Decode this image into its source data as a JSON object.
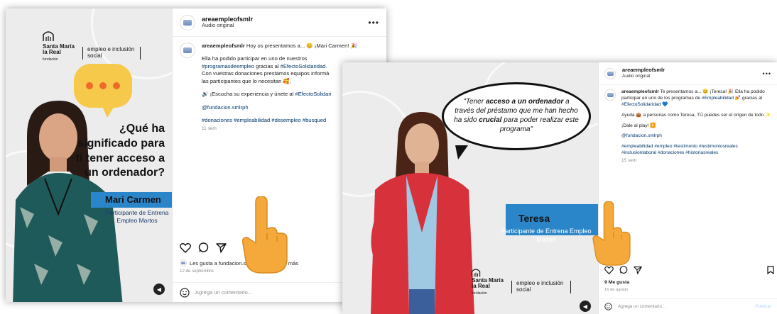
{
  "posts": [
    {
      "username": "areaempleofsmlr",
      "audio": "Audio original",
      "caption": {
        "user": "areaempleofsmlr",
        "line1": "Hoy os presentamos a... 😊 ¡Mari Carmen! 🎉",
        "p1": "Ella ha podido participar en uno de nuestros",
        "tag_programas": "#programasdeempleo",
        "p1b": "gracias al",
        "tag_efecto": "#EfectoSolidaridad.",
        "p1c": "Con vuestras donaciones prestamos equipos informá",
        "p1d": "las participantes que lo necesitan 🥰.",
        "p2": "🔊 ¡Escucha su experiencia y únete al",
        "tag_efecto2": "#EfectoSolidari",
        "mention": "@fundacion.smlrph",
        "hashtags": "#donaciones #empleabilidad #desempleo #busqued",
        "time": "11 sem"
      },
      "likes": "Les gusta a fundacion.smlrph y personas más",
      "date": "12 de septiembre",
      "comment_placeholder": "Agrega un comentario...",
      "media": {
        "logo_name": "Santa María la Real",
        "logo_sub": "fundación",
        "logo_right": "empleo e inclusión social",
        "question": "¿Qué ha significado para ti tener acceso a un ordenador?",
        "name": "Mari Carmen",
        "role": "Participante de Entrena Empleo Martos"
      }
    },
    {
      "username": "areaempleofsmlr",
      "audio": "Audio original",
      "caption": {
        "user": "areaempleofsmlr",
        "line1": "Te presentamos a... 😊 ¡Teresa! 🎉 Ella ha podido participar en uno de los programas de",
        "tag_empleabilidad": "#Empleabilidad",
        "line1b": "💅 gracias al",
        "tag_efecto": "#EfectoSolidaridad 💙",
        "p2": "Ayuda 👜 a personas como Teresa, TÚ puedes ser el origen de todo ✨",
        "p3": "¡Dale al play! ▶️",
        "mention": "@fundacion.smlrph",
        "hashtags": "#empleabilidad #empleo #testimonio #testimoniosreales #inclusionlaboral #donaciones #historiasreales",
        "time": "15 sem"
      },
      "likes": "9 Me gusta",
      "date": "16 de agosto",
      "comment_placeholder": "Agrega un comentario...",
      "publish": "Publicar",
      "media": {
        "quote_pre": "\"Tener ",
        "quote_bold1": "acceso a un ordenador",
        "quote_mid": " a través del préstamo que me han hecho ha sido ",
        "quote_bold2": "crucial",
        "quote_post": " para poder realizar este programa\"",
        "name": "Teresa",
        "role": "Participante de Entrena Empleo Madrid",
        "logo_name": "Santa María la Real",
        "logo_sub": "fundación",
        "logo_right": "empleo e inclusión social"
      }
    }
  ],
  "colors": {
    "accent_blue": "#2a86c9",
    "bubble_yellow": "#f7c94a",
    "dot_orange": "#ee6a2a",
    "hand": "#f4a93a"
  }
}
